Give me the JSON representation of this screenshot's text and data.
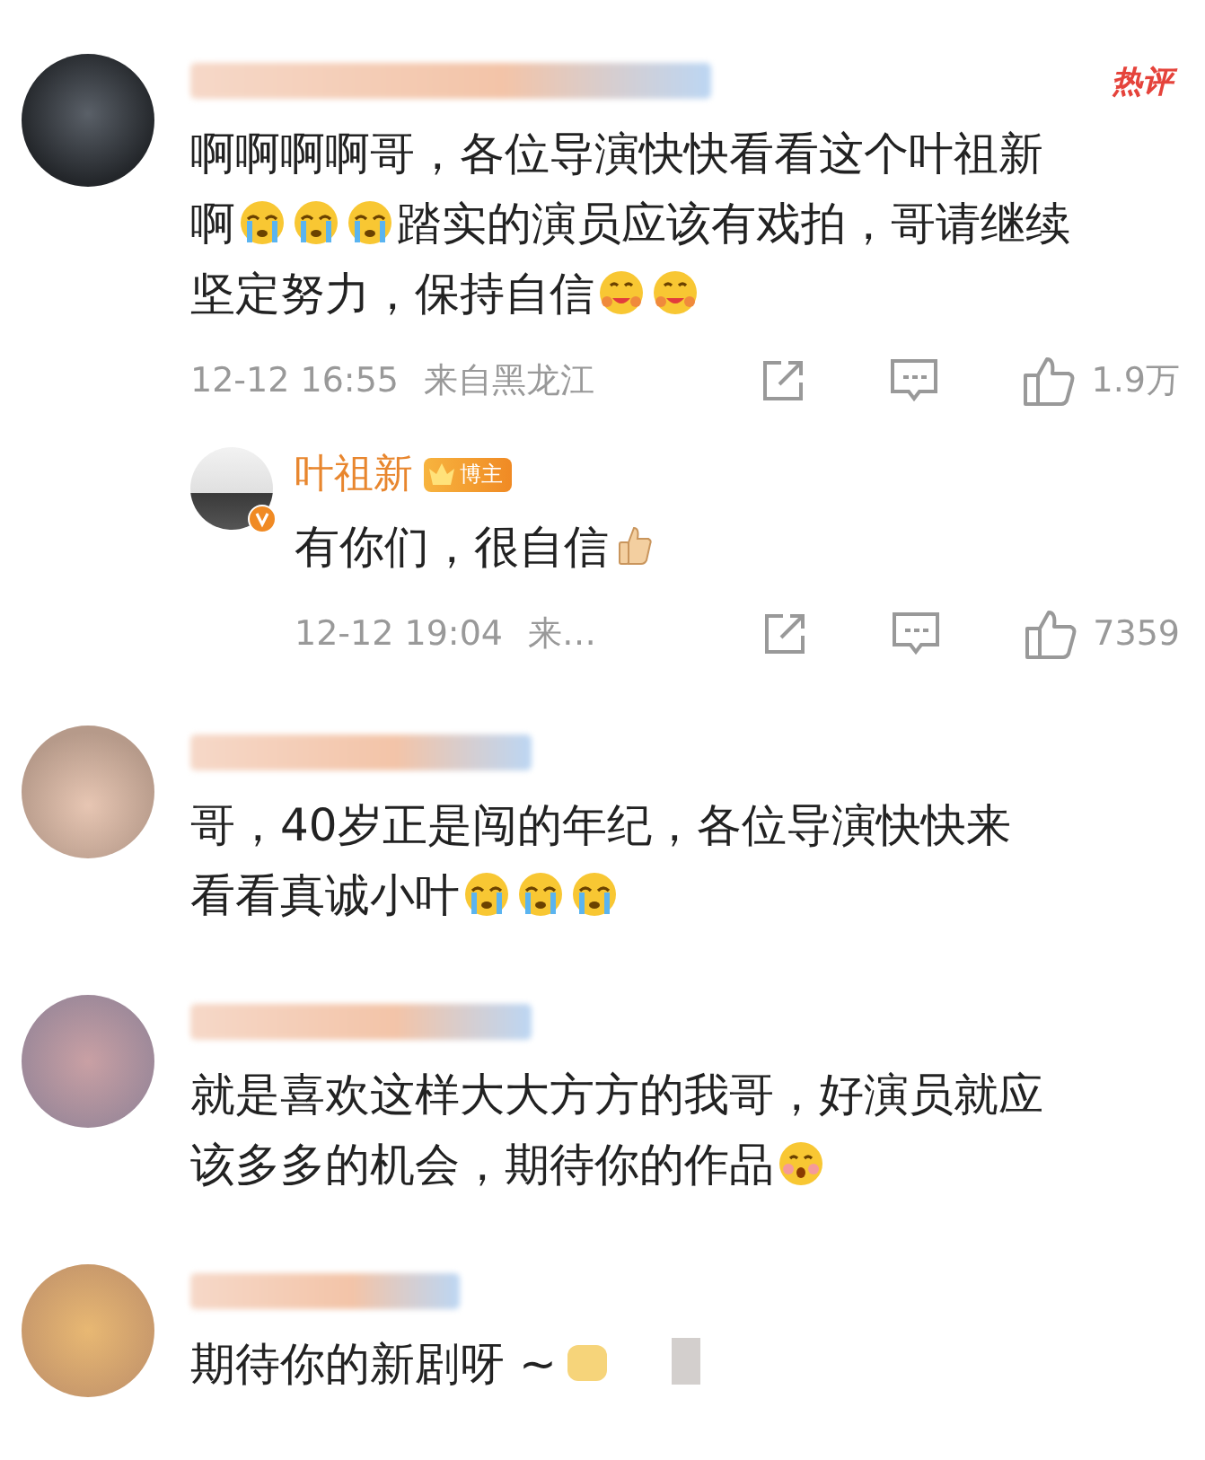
{
  "comments": [
    {
      "hot_label": "热评",
      "lines": [
        [
          {
            "kind": "text",
            "text": "啊啊啊啊哥，各位导演快快看看这个叶祖新"
          }
        ],
        [
          {
            "kind": "text",
            "text": "啊"
          },
          {
            "kind": "crying"
          },
          {
            "kind": "crying"
          },
          {
            "kind": "crying"
          },
          {
            "kind": "text",
            "text": "踏实的演员应该有戏拍，哥请继续"
          }
        ],
        [
          {
            "kind": "text",
            "text": "坚定努力，保持自信"
          },
          {
            "kind": "hug"
          },
          {
            "kind": "hug"
          }
        ]
      ],
      "meta": {
        "time": "12-12 16:55",
        "location": "来自黑龙江",
        "likes": "1.9万"
      },
      "replies": [
        {
          "name": "叶祖新",
          "badge": "博主",
          "verified": true,
          "lines": [
            [
              {
                "kind": "text",
                "text": "有你们，很自信"
              },
              {
                "kind": "thumb"
              }
            ]
          ],
          "meta": {
            "time": "12-12 19:04",
            "location": "来…",
            "likes": "7359"
          }
        }
      ]
    },
    {
      "lines": [
        [
          {
            "kind": "text",
            "text": "哥，40岁正是闯的年纪，各位导演快快来"
          }
        ],
        [
          {
            "kind": "text",
            "text": "看看真诚小叶"
          },
          {
            "kind": "crying"
          },
          {
            "kind": "crying"
          },
          {
            "kind": "crying"
          }
        ]
      ]
    },
    {
      "lines": [
        [
          {
            "kind": "text",
            "text": "就是喜欢这样大大方方的我哥，好演员就应"
          }
        ],
        [
          {
            "kind": "text",
            "text": "该多多的机会，期待你的作品"
          },
          {
            "kind": "shy"
          }
        ]
      ]
    },
    {
      "lines": [
        [
          {
            "kind": "text",
            "text": "期待你的新剧呀 ~"
          },
          {
            "kind": "sticker"
          }
        ]
      ]
    }
  ]
}
